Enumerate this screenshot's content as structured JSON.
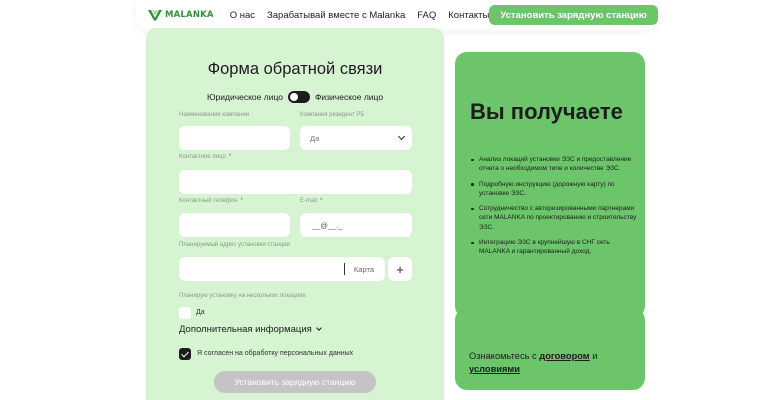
{
  "header": {
    "logo_text": "MALANKA",
    "logo_icon": "malanka-v-logo-icon",
    "nav": [
      "О нас",
      "Зарабатывай вместе с Malanka",
      "FAQ",
      "Контакты"
    ],
    "cta_label": "Установить зарядную станцию"
  },
  "form": {
    "title": "Форма обратной связи",
    "toggle_left": "Юридическое лицо",
    "toggle_right": "Физическое лицо",
    "company_name_label": "Наименование компании",
    "resident_label": "Компания резидент РБ",
    "resident_value": "Да",
    "contact_label": "Контактное лицо",
    "phone_label": "Контактный телефон",
    "email_label": "E-mail",
    "email_placeholder": "__@__._",
    "address_label": "Планируемый адрес установки станции",
    "map_label": "Карта",
    "plus_label": "+",
    "multi_label": "Планирую установку на нескольких локациях",
    "multi_option": "Да",
    "additional_label": "Дополнительная информация",
    "consent_label": "Я согласен на обработку персональных данных",
    "submit_label": "Установить зарядную станцию",
    "required_mark": "*"
  },
  "benefits": {
    "title": "Вы получаете",
    "items": [
      "Анализ локаций установки ЭЗС и предоставление отчета о необходимом типе и количестве ЭЗС.",
      "Подробную инструкцию (дорожную карту) по установке ЭЗС.",
      "Сотрудничество с авторизированными партнерами сети MALANKA по проектированию и строительству ЭЗС.",
      "Интеграцию ЭЗС в крупнейшую в СНГ сеть MALANKA и гарантированный доход."
    ]
  },
  "terms": {
    "prefix": "Ознакомьтесь с",
    "contract_link": "договором",
    "and": "и",
    "conditions_link": "условиями"
  },
  "colors": {
    "accent": "#6cc56a",
    "form_bg": "#d6f3d2",
    "disabled": "#c4c4c4"
  }
}
